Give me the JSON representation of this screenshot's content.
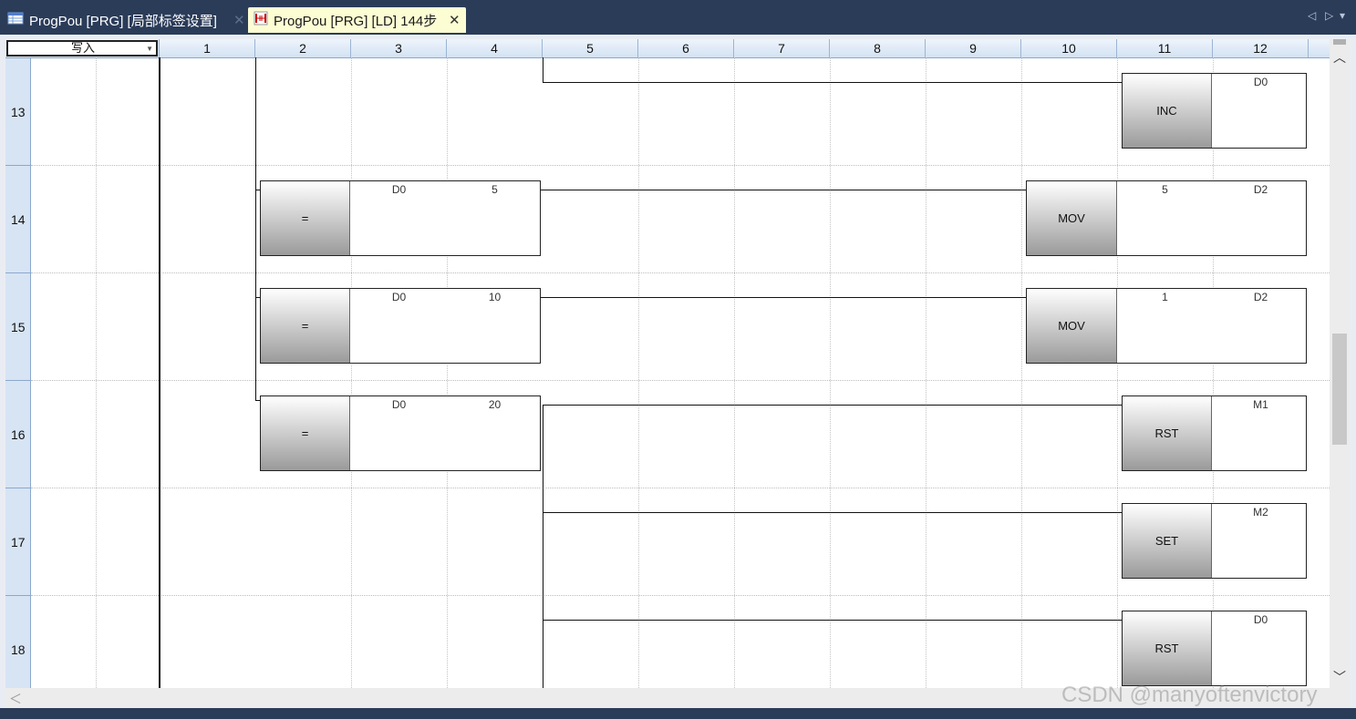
{
  "tabs": [
    {
      "label": "ProgPou [PRG] [局部标签设置]",
      "icon": "label-table-icon",
      "active": false
    },
    {
      "label": "ProgPou [PRG] [LD] 144步",
      "icon": "ladder-diagram-icon",
      "active": true
    }
  ],
  "close_glyph": "✕",
  "nav": {
    "prev": "◁",
    "next": "▷",
    "menu": "▾"
  },
  "mode": "写入",
  "columns": [
    "1",
    "2",
    "3",
    "4",
    "5",
    "6",
    "7",
    "8",
    "9",
    "10",
    "11",
    "12"
  ],
  "rows": [
    "13",
    "14",
    "15",
    "16",
    "17",
    "18"
  ],
  "blocks": {
    "r13": {
      "op": "INC",
      "arg1": "D0"
    },
    "r14_cmp": {
      "op": "=",
      "arg1": "D0",
      "arg2": "5"
    },
    "r14_out": {
      "op": "MOV",
      "arg1": "5",
      "arg2": "D2"
    },
    "r15_cmp": {
      "op": "=",
      "arg1": "D0",
      "arg2": "10"
    },
    "r15_out": {
      "op": "MOV",
      "arg1": "1",
      "arg2": "D2"
    },
    "r16_cmp": {
      "op": "=",
      "arg1": "D0",
      "arg2": "20"
    },
    "r16_out": {
      "op": "RST",
      "arg1": "M1"
    },
    "r17": {
      "op": "SET",
      "arg1": "M2"
    },
    "r18": {
      "op": "RST",
      "arg1": "D0"
    }
  },
  "scroll": {
    "up": "︿",
    "down": "﹀",
    "left": "＜"
  },
  "watermark": "CSDN @manyoftenvictory",
  "colors": {
    "tabbar": "#2b3c59",
    "active_tab": "#fdfdd4",
    "header": "#d7e4f4"
  }
}
